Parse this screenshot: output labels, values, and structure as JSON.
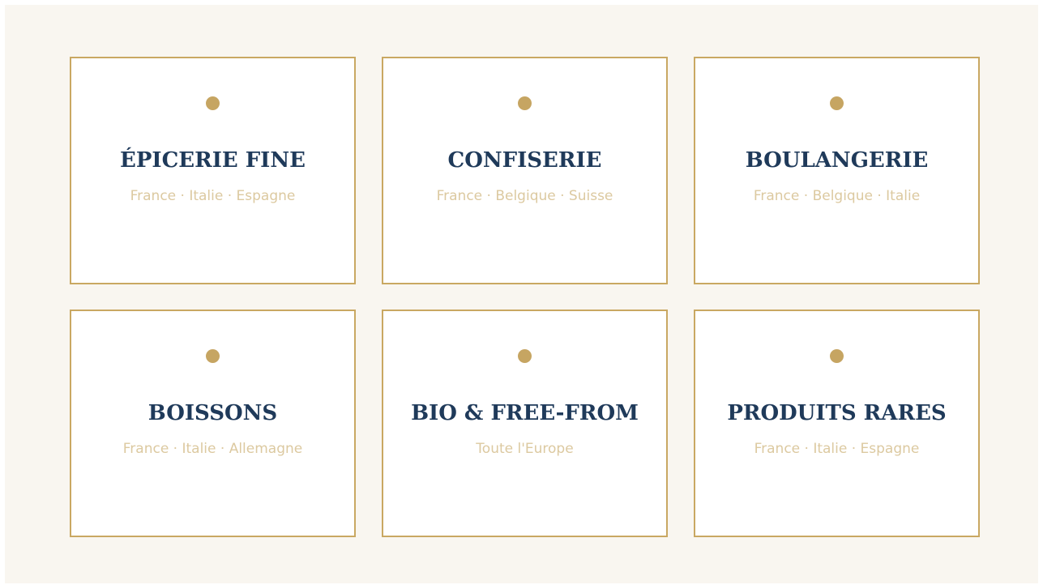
{
  "accent_color": "#c9a862",
  "title_color": "#1f3a5a",
  "categories": [
    {
      "title": "ÉPICERIE FINE",
      "origins": "France · Italie · Espagne",
      "icon": "dot-icon"
    },
    {
      "title": "CONFISERIE",
      "origins": "France · Belgique · Suisse",
      "icon": "dot-icon"
    },
    {
      "title": "BOULANGERIE",
      "origins": "France · Belgique · Italie",
      "icon": "dot-icon"
    },
    {
      "title": "BOISSONS",
      "origins": "France · Italie · Allemagne",
      "icon": "dot-icon"
    },
    {
      "title": "BIO & FREE-FROM",
      "origins": "Toute l'Europe",
      "icon": "dot-icon"
    },
    {
      "title": "PRODUITS RARES",
      "origins": "France · Italie · Espagne",
      "icon": "dot-icon"
    }
  ]
}
